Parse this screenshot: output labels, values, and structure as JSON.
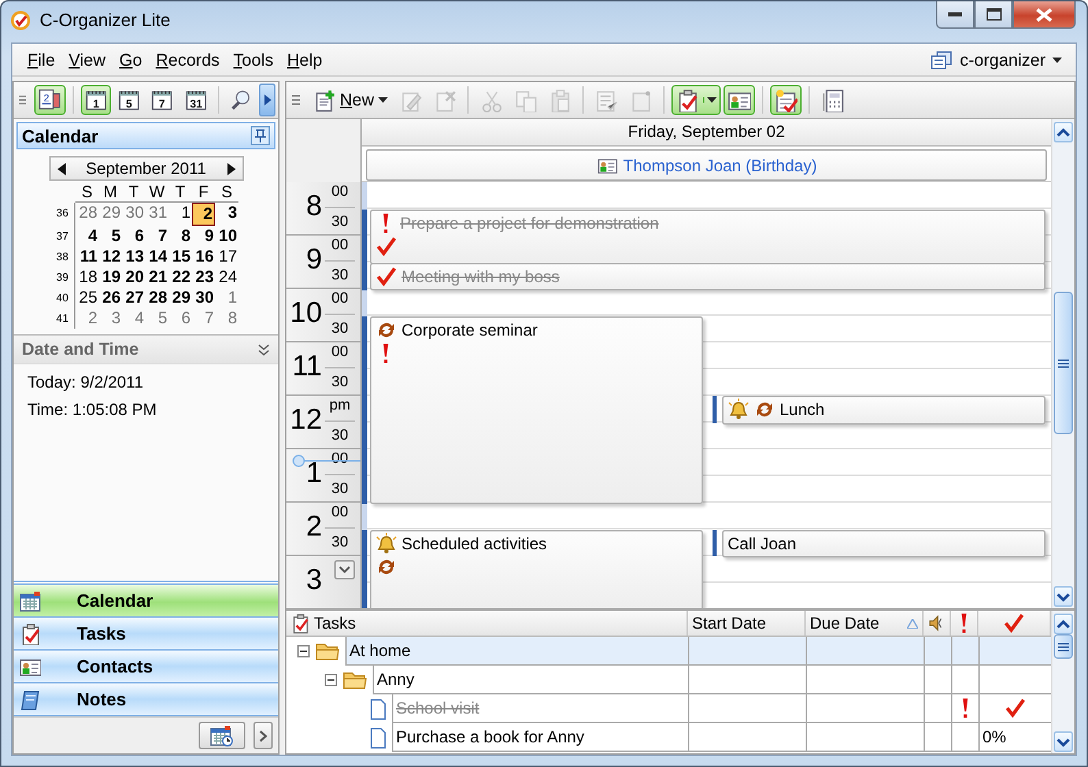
{
  "window": {
    "title": "C-Organizer Lite"
  },
  "menu": [
    {
      "label": "File"
    },
    {
      "label": "View"
    },
    {
      "label": "Go"
    },
    {
      "label": "Records"
    },
    {
      "label": "Tools"
    },
    {
      "label": "Help"
    }
  ],
  "profile": {
    "label": "c-organizer"
  },
  "left_toolbar": [
    {
      "kind": "today",
      "label": "2",
      "selected": true
    },
    {
      "kind": "view",
      "label": "1",
      "selected": true
    },
    {
      "kind": "view",
      "label": "5",
      "selected": false
    },
    {
      "kind": "view",
      "label": "7",
      "selected": false
    },
    {
      "kind": "view",
      "label": "31",
      "selected": false
    },
    {
      "kind": "search",
      "selected": false
    }
  ],
  "main_toolbar": [
    {
      "kind": "new",
      "label": "New",
      "disabled": false
    },
    {
      "kind": "edit",
      "disabled": true
    },
    {
      "kind": "delete",
      "disabled": true
    },
    {
      "kind": "cut",
      "disabled": true
    },
    {
      "kind": "copy",
      "disabled": true
    },
    {
      "kind": "paste",
      "disabled": true
    },
    {
      "kind": "checklist",
      "disabled": true
    },
    {
      "kind": "note",
      "disabled": true
    },
    {
      "kind": "task",
      "selected": true
    },
    {
      "kind": "contact",
      "selected": true
    },
    {
      "kind": "schedule",
      "selected": true
    },
    {
      "kind": "calculator",
      "selected": false
    }
  ],
  "calendar_panel": {
    "title": "Calendar",
    "month": "September 2011",
    "weekdays": [
      "S",
      "M",
      "T",
      "W",
      "T",
      "F",
      "S"
    ],
    "weeks": [
      {
        "number": "36",
        "days": [
          {
            "d": "28",
            "kind": "other"
          },
          {
            "d": "29",
            "kind": "other"
          },
          {
            "d": "30",
            "kind": "other"
          },
          {
            "d": "31",
            "kind": "other"
          },
          {
            "d": "1",
            "kind": "plain"
          },
          {
            "d": "2",
            "kind": "today"
          },
          {
            "d": "3",
            "kind": "bold"
          }
        ]
      },
      {
        "number": "37",
        "days": [
          {
            "d": "4",
            "kind": "bold"
          },
          {
            "d": "5",
            "kind": "bold"
          },
          {
            "d": "6",
            "kind": "bold"
          },
          {
            "d": "7",
            "kind": "bold"
          },
          {
            "d": "8",
            "kind": "bold"
          },
          {
            "d": "9",
            "kind": "bold"
          },
          {
            "d": "10",
            "kind": "bold"
          }
        ]
      },
      {
        "number": "38",
        "days": [
          {
            "d": "11",
            "kind": "bold"
          },
          {
            "d": "12",
            "kind": "bold"
          },
          {
            "d": "13",
            "kind": "bold"
          },
          {
            "d": "14",
            "kind": "bold"
          },
          {
            "d": "15",
            "kind": "bold"
          },
          {
            "d": "16",
            "kind": "bold"
          },
          {
            "d": "17",
            "kind": "plain"
          }
        ]
      },
      {
        "number": "39",
        "days": [
          {
            "d": "18",
            "kind": "plain"
          },
          {
            "d": "19",
            "kind": "bold"
          },
          {
            "d": "20",
            "kind": "bold"
          },
          {
            "d": "21",
            "kind": "bold"
          },
          {
            "d": "22",
            "kind": "bold"
          },
          {
            "d": "23",
            "kind": "bold"
          },
          {
            "d": "24",
            "kind": "plain"
          }
        ]
      },
      {
        "number": "40",
        "days": [
          {
            "d": "25",
            "kind": "plain"
          },
          {
            "d": "26",
            "kind": "bold"
          },
          {
            "d": "27",
            "kind": "bold"
          },
          {
            "d": "28",
            "kind": "bold"
          },
          {
            "d": "29",
            "kind": "bold"
          },
          {
            "d": "30",
            "kind": "bold"
          },
          {
            "d": "1",
            "kind": "other"
          }
        ]
      },
      {
        "number": "41",
        "days": [
          {
            "d": "2",
            "kind": "other"
          },
          {
            "d": "3",
            "kind": "other"
          },
          {
            "d": "4",
            "kind": "other"
          },
          {
            "d": "5",
            "kind": "other"
          },
          {
            "d": "6",
            "kind": "other"
          },
          {
            "d": "7",
            "kind": "other"
          },
          {
            "d": "8",
            "kind": "other"
          }
        ]
      }
    ]
  },
  "date_time_panel": {
    "title": "Date and Time",
    "lines": [
      "Today: 9/2/2011",
      "Time: 1:05:08 PM"
    ]
  },
  "navigation": [
    {
      "label": "Calendar",
      "kind": "calendar",
      "selected": true
    },
    {
      "label": "Tasks",
      "kind": "tasks",
      "selected": false
    },
    {
      "label": "Contacts",
      "kind": "contacts",
      "selected": false
    },
    {
      "label": "Notes",
      "kind": "notes",
      "selected": false
    }
  ],
  "day_view": {
    "date": "Friday, September 02",
    "all_day": [
      {
        "title": "Thompson Joan (Birthday)"
      }
    ],
    "hours": [
      {
        "hour": "8",
        "suffix": "00",
        "half": "30"
      },
      {
        "hour": "9",
        "suffix": "00",
        "half": "30"
      },
      {
        "hour": "10",
        "suffix": "00",
        "half": "30"
      },
      {
        "hour": "11",
        "suffix": "00",
        "half": "30"
      },
      {
        "hour": "12",
        "suffix": "pm",
        "half": "30"
      },
      {
        "hour": "1",
        "suffix": "00",
        "half": "30"
      },
      {
        "hour": "2",
        "suffix": "00",
        "half": "30"
      },
      {
        "hour": "3"
      }
    ],
    "events": [
      {
        "title": "Prepare a project for demonstration",
        "completed": true,
        "important": true,
        "recurring": false,
        "reminder": false
      },
      {
        "title": "Meeting with my boss",
        "completed": true,
        "important": false,
        "recurring": false,
        "reminder": false
      },
      {
        "title": "Corporate seminar",
        "completed": false,
        "important": true,
        "recurring": true,
        "reminder": false
      },
      {
        "title": "Lunch",
        "completed": false,
        "important": false,
        "recurring": true,
        "reminder": true
      },
      {
        "title": "Scheduled activities",
        "completed": false,
        "important": false,
        "recurring": true,
        "reminder": true
      },
      {
        "title": "Call Joan",
        "completed": false,
        "important": false,
        "recurring": false,
        "reminder": false
      }
    ]
  },
  "tasks": {
    "title": "Tasks",
    "columns": [
      "Start Date",
      "Due Date"
    ],
    "rows": [
      {
        "name": "At home",
        "kind": "folder",
        "expanded": true,
        "selected": true,
        "children": [
          {
            "name": "Anny",
            "kind": "folder",
            "expanded": true,
            "selected": false,
            "children": [
              {
                "name": "School visit",
                "kind": "task",
                "completed": true,
                "important": true,
                "selected": false
              },
              {
                "name": "Purchase a book for Anny",
                "kind": "task",
                "completed": false,
                "important": false,
                "progress": "0%",
                "selected": false
              }
            ]
          }
        ]
      }
    ]
  }
}
